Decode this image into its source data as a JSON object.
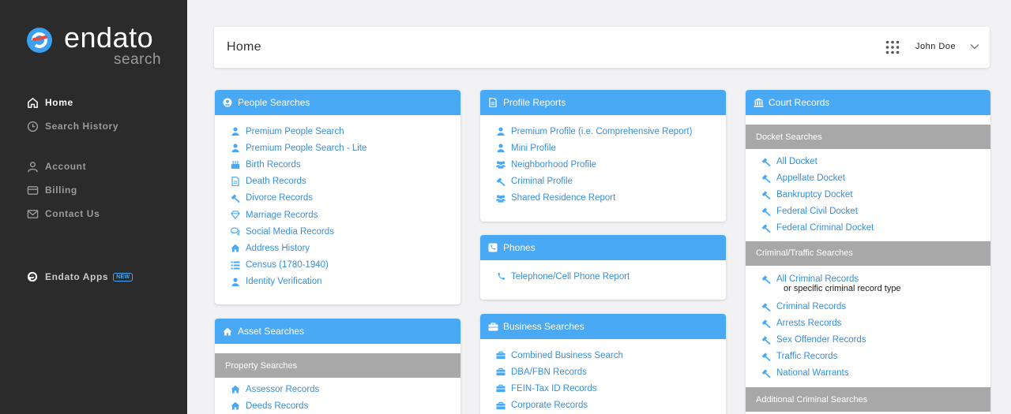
{
  "brand": {
    "name": "endato",
    "sub": "search"
  },
  "nav": {
    "home": "Home",
    "search_history": "Search History",
    "account": "Account",
    "billing": "Billing",
    "contact_us": "Contact Us",
    "endato_apps": "Endato Apps",
    "new_badge": "NEW"
  },
  "header": {
    "title": "Home",
    "user": "John Doe"
  },
  "people": {
    "title": "People Searches",
    "items": [
      "Premium People Search",
      "Premium People Search - Lite",
      "Birth Records",
      "Death Records",
      "Divorce Records",
      "Marriage Records",
      "Social Media Records",
      "Address History",
      "Census (1780-1940)",
      "Identity Verification"
    ]
  },
  "asset": {
    "title": "Asset Searches",
    "property_head": "Property Searches",
    "items": [
      "Assessor Records",
      "Deeds Records"
    ]
  },
  "profile": {
    "title": "Profile Reports",
    "items": [
      "Premium Profile (i.e. Comprehensive Report)",
      "Mini Profile",
      "Neighborhood Profile",
      "Criminal Profile",
      "Shared Residence Report"
    ]
  },
  "phones": {
    "title": "Phones",
    "items": [
      "Telephone/Cell Phone Report"
    ]
  },
  "business": {
    "title": "Business Searches",
    "items": [
      "Combined Business Search",
      "DBA/FBN Records",
      "FEIN-Tax ID Records",
      "Corporate Records"
    ]
  },
  "court": {
    "title": "Court Records",
    "docket_head": "Docket Searches",
    "docket_items": [
      "All Docket",
      "Appellate Docket",
      "Bankruptcy Docket",
      "Federal Civil Docket",
      "Federal Criminal Docket"
    ],
    "criminal_head": "Criminal/Traffic Searches",
    "all_criminal": "All Criminal Records",
    "note": "or specific criminal record type",
    "criminal_items": [
      "Criminal Records",
      "Arrests Records",
      "Sex Offender Records",
      "Traffic Records",
      "National Warrants"
    ],
    "additional_head": "Additional Criminal Searches"
  },
  "colors": {
    "accent": "#4aa9f5",
    "link": "#3a8fd8",
    "sidebar": "#2b2b2c",
    "subhead": "#a8a8a8"
  }
}
